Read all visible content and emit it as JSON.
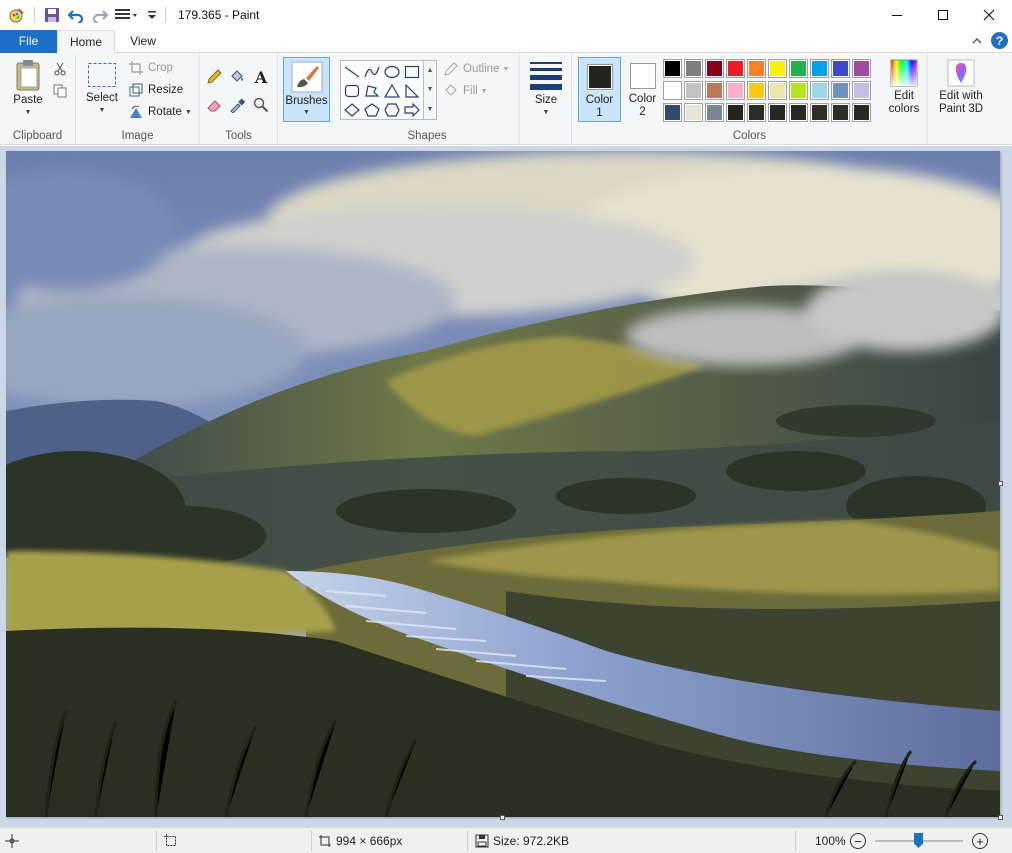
{
  "window": {
    "title": "179.365 - Paint"
  },
  "tabs": [
    {
      "label": "File"
    },
    {
      "label": "Home"
    },
    {
      "label": "View"
    }
  ],
  "ribbon": {
    "clipboard": {
      "group_label": "Clipboard",
      "paste_label": "Paste"
    },
    "image": {
      "group_label": "Image",
      "select_label": "Select",
      "crop_label": "Crop",
      "resize_label": "Resize",
      "rotate_label": "Rotate"
    },
    "tools": {
      "group_label": "Tools"
    },
    "brushes": {
      "label": "Brushes"
    },
    "shapes": {
      "group_label": "Shapes",
      "outline_label": "Outline",
      "fill_label": "Fill"
    },
    "size": {
      "label": "Size"
    },
    "colors": {
      "group_label": "Colors",
      "color1_label": "Color 1",
      "color2_label": "Color 2",
      "color1_value": "#23241f",
      "color2_value": "#ffffff",
      "edit_colors_label": "Edit colors",
      "palette": [
        "#000000",
        "#7f7f7f",
        "#880015",
        "#ed1c24",
        "#ff7f27",
        "#fff200",
        "#22b14c",
        "#00a2e8",
        "#3f48cc",
        "#a349a4",
        "#ffffff",
        "#c3c3c3",
        "#b97a57",
        "#ffaec9",
        "#ffc90e",
        "#efe4b0",
        "#b5e61d",
        "#99d9ea",
        "#7092be",
        "#c8bfe7",
        "#2f4a6e",
        "#e9e5d6",
        "#7a8590",
        "#23241f",
        "#2a2d22",
        "#26291f",
        "#28291f",
        "#2d301f",
        "#2b2e22",
        "#272a20"
      ]
    },
    "paint3d": {
      "label": "Edit with Paint 3D"
    }
  },
  "status": {
    "dimensions": "994 × 666px",
    "size": "Size: 972.2KB",
    "zoom": "100%"
  }
}
